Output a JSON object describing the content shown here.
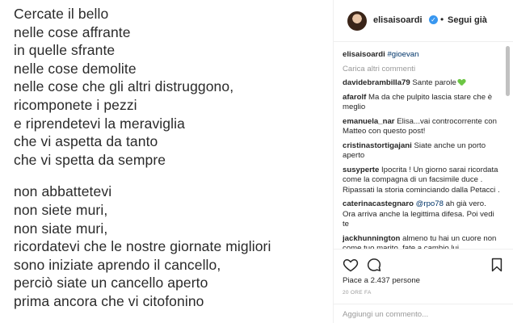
{
  "poem": {
    "stanza1": [
      "Cercate il bello",
      "nelle cose affrante",
      "in quelle sfrante",
      "nelle cose demolite",
      "nelle cose che gli altri distruggono,",
      "ricomponete i pezzi",
      "e riprendetevi la meraviglia",
      "che vi aspetta da tanto",
      "che vi spetta da sempre"
    ],
    "stanza2": [
      "non abbattetevi",
      "non siete muri,",
      "non siate muri,",
      "ricordatevi che le nostre giornate migliori",
      "sono iniziate aprendo il cancello,",
      "perciò siate un cancello aperto",
      "prima ancora che vi citofonino"
    ]
  },
  "header": {
    "username": "elisaisoardi",
    "separator": "•",
    "follow_status": "Segui già",
    "verified_icon": "verified-badge-icon"
  },
  "caption": {
    "username": "elisaisoardi",
    "hashtag": "#gioevan"
  },
  "load_more": "Carica altri commenti",
  "comments": [
    {
      "user": "davidebrambilla79",
      "text": "Sante parole",
      "emoji": "green-heart-icon"
    },
    {
      "user": "afarolf",
      "text": "Ma da che pulpito lascia stare che è meglio"
    },
    {
      "user": "emanuela_nar",
      "text": "Elisa...vai controcorrente con Matteo con questo post!"
    },
    {
      "user": "cristinastortigajani",
      "text": "Siate anche un porto aperto"
    },
    {
      "user": "susyperte",
      "text": "Ipocrita ! Un giorno sarai ricordata come la compagna di un facsimile duce . Ripassati la storia cominciando dalla Petacci ."
    },
    {
      "user": "caterinacastegnaro",
      "mention": "@rpo78",
      "text": "ah già vero. Ora arriva anche la legittima difesa. Poi vedi te"
    },
    {
      "user": "jackhunnington",
      "text": "almeno tu hai un cuore non come tuo marito, fate a cambio lui"
    }
  ],
  "actions": {
    "like_icon": "heart-icon",
    "comment_icon": "comment-icon",
    "save_icon": "bookmark-icon",
    "likes": "Piace a 2.437 persone",
    "time": "20 ORE FA"
  },
  "comment_box": {
    "placeholder": "Aggiungi un commento..."
  },
  "colors": {
    "link": "#003569",
    "muted": "#999999",
    "verified": "#3897f0",
    "border": "#efefef"
  }
}
